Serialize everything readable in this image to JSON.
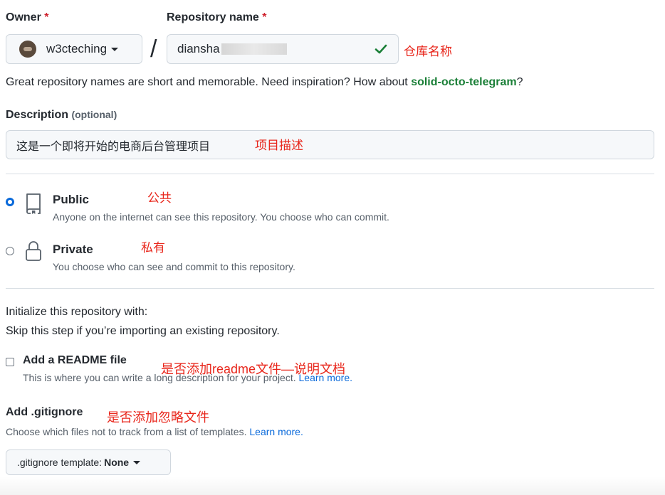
{
  "owner": {
    "label": "Owner",
    "required_mark": "*",
    "value": "w3cteching",
    "avatar_icon": "avatar-image"
  },
  "repo": {
    "label": "Repository name",
    "required_mark": "*",
    "separator": "/",
    "value_visible": "diansha",
    "value_redacted": true,
    "valid_icon": "checkmark-icon",
    "annotation": "仓库名称"
  },
  "name_hint": {
    "prefix": "Great repository names are short and memorable. Need inspiration? How about ",
    "suggestion": "solid-octo-telegram",
    "suffix": "?"
  },
  "description": {
    "label": "Description",
    "optional": "(optional)",
    "value": "这是一个即将开始的电商后台管理项目",
    "annotation": "项目描述"
  },
  "visibility": {
    "public": {
      "title": "Public",
      "subtitle": "Anyone on the internet can see this repository. You choose who can commit.",
      "annotation": "公共",
      "selected": true,
      "icon": "repo-icon"
    },
    "private": {
      "title": "Private",
      "subtitle": "You choose who can see and commit to this repository.",
      "annotation": "私有",
      "selected": false,
      "icon": "lock-icon"
    }
  },
  "init": {
    "title": "Initialize this repository with:",
    "subtitle": "Skip this step if you’re importing an existing repository.",
    "readme": {
      "title": "Add a README file",
      "checked": false,
      "desc": "This is where you can write a long description for your project. ",
      "link": "Learn more.",
      "annotation": "是否添加readme文件—说明文档"
    }
  },
  "gitignore": {
    "title": "Add .gitignore",
    "annotation": "是否添加忽略文件",
    "desc": "Choose which files not to track from a list of templates. ",
    "link": "Learn more.",
    "select_prefix": ".gitignore template: ",
    "select_value": "None"
  },
  "colors": {
    "accent": "#0969da",
    "success": "#1a7f37",
    "required": "#cf222e",
    "annotation": "#e8261b"
  }
}
